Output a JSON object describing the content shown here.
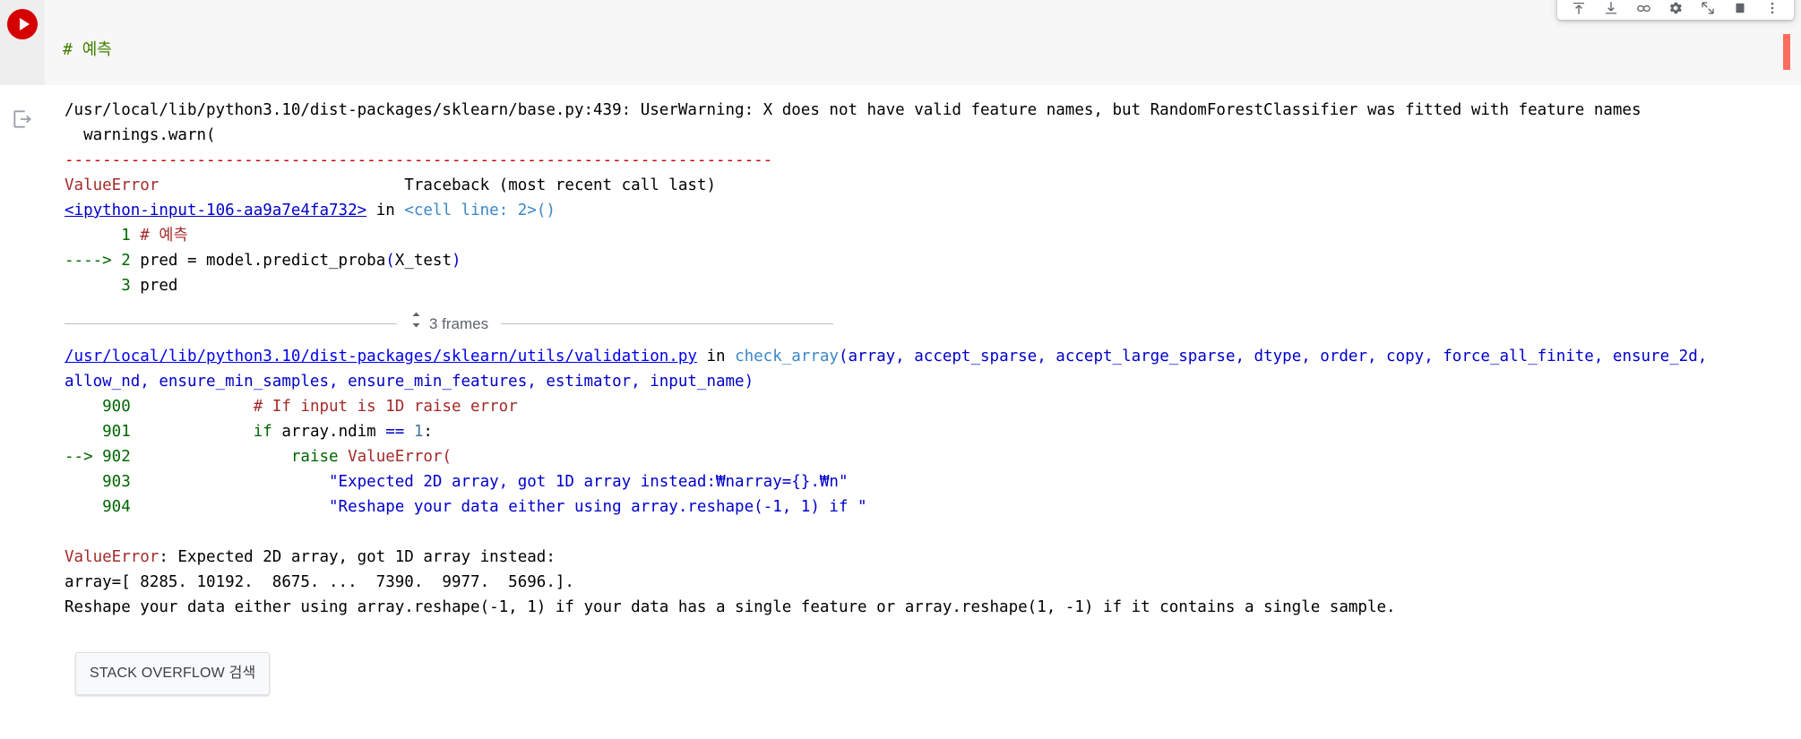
{
  "toolbar": {
    "items": [
      {
        "name": "move-cell-up-icon",
        "label": "Move cell up"
      },
      {
        "name": "move-cell-down-icon",
        "label": "Move cell down"
      },
      {
        "name": "link-to-cell-icon",
        "label": "Link to cell"
      },
      {
        "name": "gear-icon",
        "label": "Cell settings"
      },
      {
        "name": "open-in-new-tab-icon",
        "label": "Open in new tab"
      },
      {
        "name": "delete-cell-icon",
        "label": "Delete cell"
      },
      {
        "name": "more-vert-icon",
        "label": "More cell actions"
      }
    ]
  },
  "input_cell": {
    "run_button_name": "run-cell-button",
    "code": {
      "line1_comment": "# 예측",
      "line1_comment_hash": "# ",
      "line1_comment_text": "예측",
      "line2_plain": "pred = model.predict_proba",
      "line2_open": "(",
      "line2_arg": "X_test",
      "line2_close": ")",
      "line3": "pred"
    }
  },
  "output_cell": {
    "output_icon_name": "output-stream-icon",
    "warning_line": "/usr/local/lib/python3.10/dist-packages/sklearn/base.py:439: UserWarning: X does not have valid feature names, but RandomForestClassifier was fitted with feature names",
    "warning_line2": "  warnings.warn(",
    "separator": "---------------------------------------------------------------------------",
    "exception_name": "ValueError",
    "traceback_header": "Traceback (most recent call last)",
    "frame1": {
      "file": "<ipython-input-106-aa9a7e4fa732>",
      "in_word": " in ",
      "func": "<cell line: 2>()",
      "lines": [
        {
          "marker": "",
          "no": "1",
          "code_comment": "# 예측",
          "code_plain": "",
          "kind": "comment"
        },
        {
          "marker": "----> ",
          "no": "2",
          "code_plain": "pred = model.predict_proba",
          "paren_open": "(",
          "arg": "X_test",
          "paren_close": ")",
          "kind": "code"
        },
        {
          "marker": "",
          "no": "3",
          "code_plain": "pred",
          "kind": "plain"
        }
      ]
    },
    "frames_toggle": {
      "label": "3 frames",
      "icon": "unfold-more-icon"
    },
    "frame2": {
      "file": "/usr/local/lib/python3.10/dist-packages/sklearn/utils/validation.py",
      "in_word": " in ",
      "func": "check_array",
      "args_line1": "(array, accept_sparse, accept_large_sparse, dtype, order, copy, force_all_finite, ensure_2d,",
      "args_line2": "allow_nd, ensure_min_samples, ensure_min_features, estimator, input_name)",
      "lines": [
        {
          "marker": "",
          "no": "900",
          "indent": "            ",
          "kind": "comment",
          "text": "# If input is 1D raise error"
        },
        {
          "marker": "",
          "no": "901",
          "indent": "            ",
          "kind": "if",
          "kw": "if",
          "rest": " array.ndim ",
          "op": "==",
          "num": " 1",
          "tail": ":"
        },
        {
          "marker": "--> ",
          "no": "902",
          "indent": "                ",
          "kind": "raise",
          "kw": "raise",
          "exc": " ValueError("
        },
        {
          "marker": "",
          "no": "903",
          "indent": "                    ",
          "kind": "string",
          "text": "\"Expected 2D array, got 1D array instead:₩narray={}.₩n\""
        },
        {
          "marker": "",
          "no": "904",
          "indent": "                    ",
          "kind": "string",
          "text": "\"Reshape your data either using array.reshape(-1, 1) if \""
        }
      ]
    },
    "final_error": {
      "name": "ValueError",
      "colon_msg": ": Expected 2D array, got 1D array instead:",
      "array_line": "array=[ 8285. 10192.  8675. ...  7390.  9977.  5696.].",
      "reshape_line": "Reshape your data either using array.reshape(-1, 1) if your data has a single feature or array.reshape(1, -1) if it contains a single sample."
    },
    "stack_overflow_button": "STACK OVERFLOW 검색"
  },
  "colors": {
    "error_red": "#a52a2a",
    "separator_red": "#cc0000",
    "link_blue": "#0000ee",
    "keyword_green": "#006600",
    "string_blue": "#0000cc",
    "run_button_red": "#d50000",
    "exec_marker": "#ff6d5f"
  }
}
